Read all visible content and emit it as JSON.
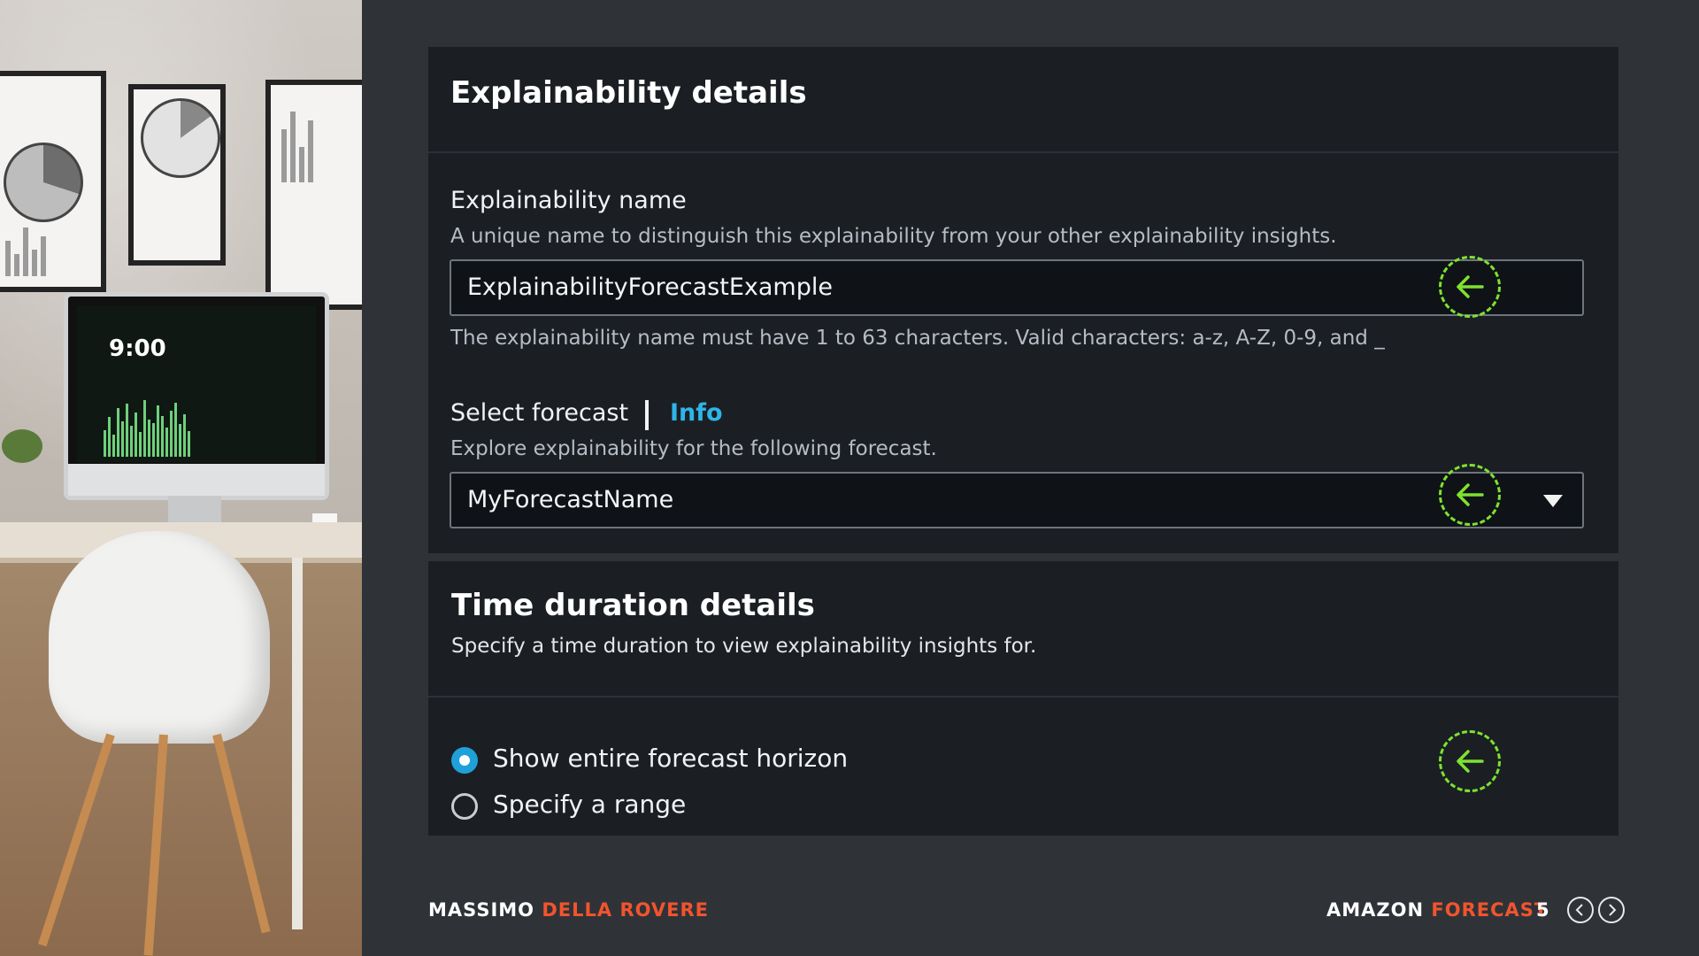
{
  "card1": {
    "title": "Explainability details",
    "name_field": {
      "label": "Explainability name",
      "description": "A unique name to distinguish this explainability from your other explainability insights.",
      "value": "ExplainabilityForecastExample",
      "constraint": "The explainability name must have 1 to 63 characters. Valid characters: a-z, A-Z, 0-9, and _"
    },
    "forecast_field": {
      "label": "Select forecast",
      "info_link": "Info",
      "description": "Explore explainability for the following forecast.",
      "selected": "MyForecastName"
    }
  },
  "card2": {
    "title": "Time duration details",
    "description": "Specify a time duration to view explainability insights for.",
    "options": [
      {
        "label": "Show entire forecast horizon",
        "selected": true
      },
      {
        "label": "Specify a range",
        "selected": false
      }
    ]
  },
  "footer": {
    "author_first": "MASSIMO",
    "author_last": "DELLA ROVERE",
    "product_first": "AMAZON",
    "product_last": "FORECAST",
    "page_number": "5"
  },
  "photo": {
    "monitor_clock": "9:00"
  },
  "colors": {
    "accent_orange": "#f2542d",
    "link_blue": "#2eb5e8",
    "marker_green": "#7ee22f",
    "radio_blue": "#1fa0d8"
  }
}
